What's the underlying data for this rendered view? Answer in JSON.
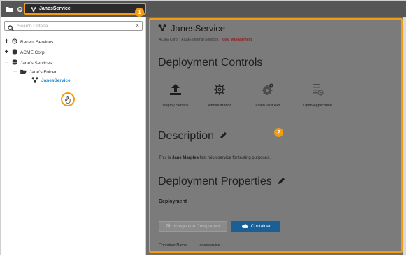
{
  "topbar": {
    "active_tab_label": "JanesService",
    "callout_1": "1"
  },
  "tree": {
    "search_placeholder": "Search Criteria",
    "clear_symbol": "×",
    "items": [
      {
        "toggle": "+",
        "label": "Recent Services",
        "icon": "clock-icon"
      },
      {
        "toggle": "+",
        "label": "ACME Corp.",
        "icon": "database-icon"
      },
      {
        "toggle": "−",
        "label": "Jane's Services",
        "icon": "database-icon"
      },
      {
        "toggle": "−",
        "label": "Jane's Folder",
        "icon": "folder-icon"
      },
      {
        "toggle": "",
        "label": "JanesService",
        "icon": "service-icon"
      }
    ]
  },
  "main": {
    "service_title": "JanesService",
    "breadcrumb": {
      "part1": "ACME Corp.",
      "sep": "›",
      "part2": "ACME Internal Services",
      "current": "Idea_Management"
    },
    "deployment_controls_title": "Deployment Controls",
    "actions": [
      {
        "label": "Deploy Service",
        "icon": "upload-icon"
      },
      {
        "label": "Administration",
        "icon": "gear-network-icon"
      },
      {
        "label": "Open Test API",
        "icon": "gear-play-icon"
      },
      {
        "label": "Open Application",
        "icon": "list-settings-icon"
      }
    ],
    "description_title": "Description",
    "description": {
      "prefix": "This is ",
      "owner": "Jane Marples",
      "suffix": " first microservice for testing purposes."
    },
    "properties_title": "Deployment Properties",
    "deployment_subheading": "Deployment",
    "tabs": [
      {
        "label": "Integration Component",
        "icon": "settings-icon",
        "active": false
      },
      {
        "label": "Container",
        "icon": "cloud-icon",
        "active": true
      }
    ],
    "container_name_label": "Container Name:",
    "container_name_value": "janesservice",
    "callout_2": "2"
  },
  "colors": {
    "highlight": "#f39c12",
    "selected_link": "#1f8ad2",
    "active_tab": "#1a5f96",
    "breadcrumb_current": "#8e1b1b"
  }
}
